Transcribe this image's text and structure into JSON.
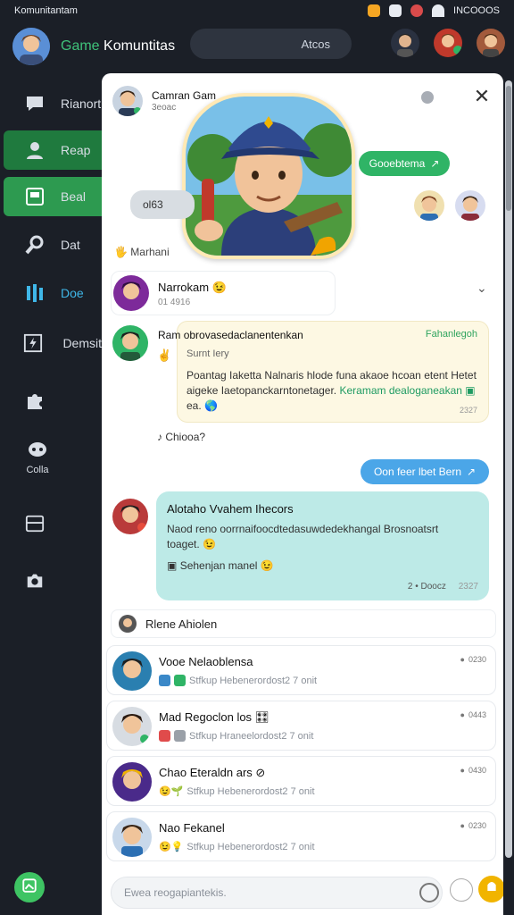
{
  "status_bar": {
    "left_text": "Komunitantam",
    "right_text": "INCOOOS"
  },
  "app": {
    "title_green": "Game",
    "title_rest": "Komuntitas",
    "search_placeholder": "Atcos"
  },
  "sidebar": {
    "items": [
      {
        "label": "Rianort",
        "icon": "chat-bubble-icon"
      },
      {
        "label": "Reap",
        "icon": "user-icon",
        "active": true
      },
      {
        "label": "Beal",
        "icon": "board-icon",
        "active": true
      },
      {
        "label": "Dat",
        "icon": "wrench-icon"
      },
      {
        "label": "Doe",
        "icon": "bars-icon"
      },
      {
        "label": "Demsit",
        "icon": "lightning-icon"
      },
      {
        "label": "",
        "icon": "puzzle-icon"
      },
      {
        "label": "Colla",
        "icon": "gamepad-icon"
      },
      {
        "label": "",
        "icon": "window-icon"
      },
      {
        "label": "",
        "icon": "camera-icon"
      }
    ]
  },
  "chat": {
    "header_name": "Camran Gam",
    "header_sub": "3eoac",
    "pill_green": "Gooebtema",
    "pill_grey": "ol63",
    "section_label": "Marhani",
    "notif": {
      "name": "Narrokam",
      "sub": "01 4916"
    },
    "card": {
      "sender": "Ram",
      "title_line": "obrovasedaclanentenkan",
      "link": "Fahanlegoh",
      "subtitle": "Surnt Iery",
      "body": "Poantag Iaketta Nalnaris hlode funa akaoe hcoan etent Hetet aigeke Iaetopanckarntonetager.",
      "body_link": "Keramam dealoganeakan",
      "body_end": "ea.",
      "time": "2327"
    },
    "reply_mini": "Chiooa?",
    "bubble_out": "Oon feer lbet Bern",
    "bubble_in": {
      "title": "Alotaho Vvahem Ihecors",
      "text": "Naod reno oorrnaifoocdtedasuwdedekhangal Brosnoatsrt toaget.",
      "attachment": "Sehenjan manel",
      "meta_left": "2 • Doocz",
      "meta_right": "2327"
    },
    "group_head": "Rlene Ahiolen",
    "list": [
      {
        "name": "Vooe Nelaoblensa",
        "preview": "Stfkup Hebenerordost2 7 onit",
        "time": "0230"
      },
      {
        "name": "Mad Regoclon los",
        "preview": "Stfkup Hraneelordost2 7 onit",
        "time": "0443"
      },
      {
        "name": "Chao Eteraldn ars",
        "preview": "Stfkup Hebenerordost2 7 onit",
        "time": "0430"
      },
      {
        "name": "Nao Fekanel",
        "preview": "Stfkup Hebenerordost2 7 onit",
        "time": "0230"
      }
    ],
    "composer_placeholder": "Ewea reogapiantekis."
  },
  "colors": {
    "accent_green": "#2fb466",
    "accent_blue": "#4ba6e8",
    "send_yellow": "#f1b400",
    "bg_dark": "#1b1f27"
  }
}
